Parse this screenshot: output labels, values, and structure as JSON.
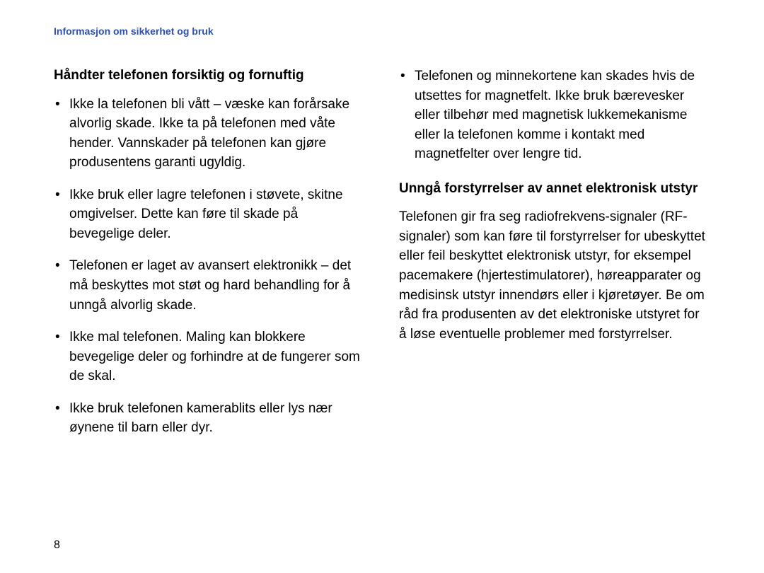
{
  "header": {
    "running_title": "Informasjon om sikkerhet og bruk"
  },
  "left": {
    "heading": "Håndter telefonen forsiktig og fornuftig",
    "bullets": [
      "Ikke la telefonen bli vått – væske kan forårsake alvorlig skade. Ikke ta på telefonen med våte hender. Vannskader på telefonen kan gjøre produsentens garanti ugyldig.",
      "Ikke bruk eller lagre telefonen i støvete, skitne omgivelser. Dette kan føre til skade på bevegelige deler.",
      "Telefonen er laget av avansert elektronikk – det må beskyttes mot støt og hard behandling for å unngå alvorlig skade.",
      "Ikke mal telefonen. Maling kan blokkere bevegelige deler og forhindre at de fungerer som de skal.",
      "Ikke bruk telefonen kamerablits eller lys nær øynene til barn eller dyr."
    ]
  },
  "right": {
    "bullets": [
      "Telefonen og minnekortene kan skades hvis de utsettes for magnetfelt. Ikke bruk bærevesker eller tilbehør med magnetisk lukkemekanisme eller la telefonen komme i kontakt med magnetfelter over lengre tid."
    ],
    "heading": "Unngå forstyrrelser av annet elektronisk utstyr",
    "paragraph": "Telefonen gir fra seg radiofrekvens-signaler (RF-signaler) som kan føre til forstyrrelser for ubeskyttet eller feil beskyttet elektronisk utstyr, for eksempel pacemakere (hjertestimulatorer), høreapparater og medisinsk utstyr innendørs eller i kjøretøyer. Be om råd fra produsenten av det elektroniske utstyret for å løse eventuelle problemer med forstyrrelser."
  },
  "page_number": "8"
}
